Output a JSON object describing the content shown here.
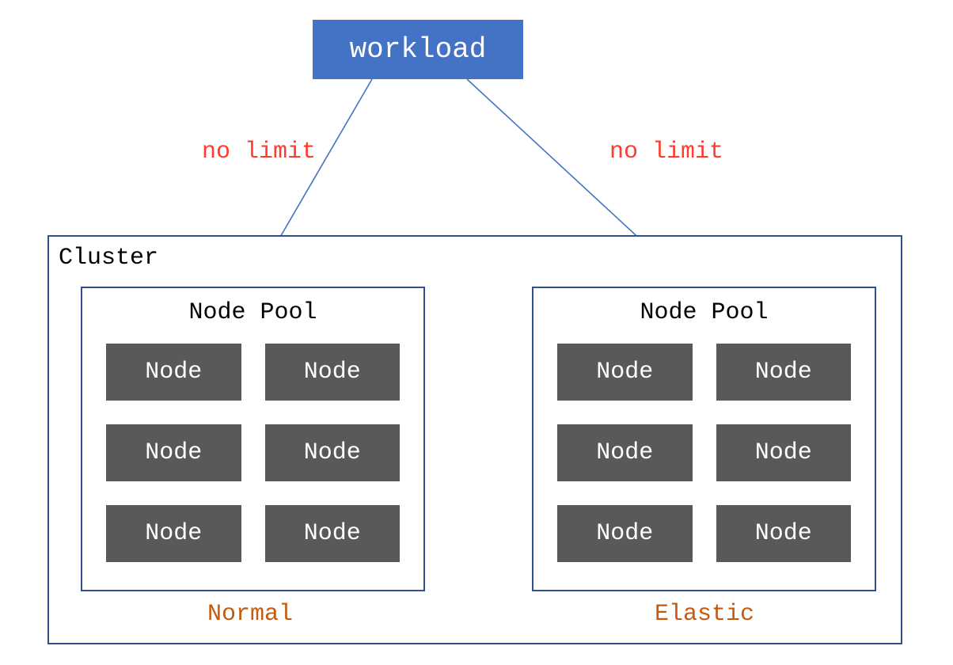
{
  "workload": {
    "label": "workload"
  },
  "edges": {
    "left_label": "no limit",
    "right_label": "no limit"
  },
  "cluster": {
    "label": "Cluster",
    "pools": [
      {
        "title": "Node Pool",
        "caption": "Normal",
        "nodes": [
          "Node",
          "Node",
          "Node",
          "Node",
          "Node",
          "Node"
        ]
      },
      {
        "title": "Node Pool",
        "caption": "Elastic",
        "nodes": [
          "Node",
          "Node",
          "Node",
          "Node",
          "Node",
          "Node"
        ]
      }
    ]
  },
  "colors": {
    "workload_bg": "#4472c4",
    "node_bg": "#595959",
    "border": "#2f528f",
    "edge_label": "#ff3b30",
    "caption": "#c55a11",
    "arrow": "#4472c4"
  }
}
